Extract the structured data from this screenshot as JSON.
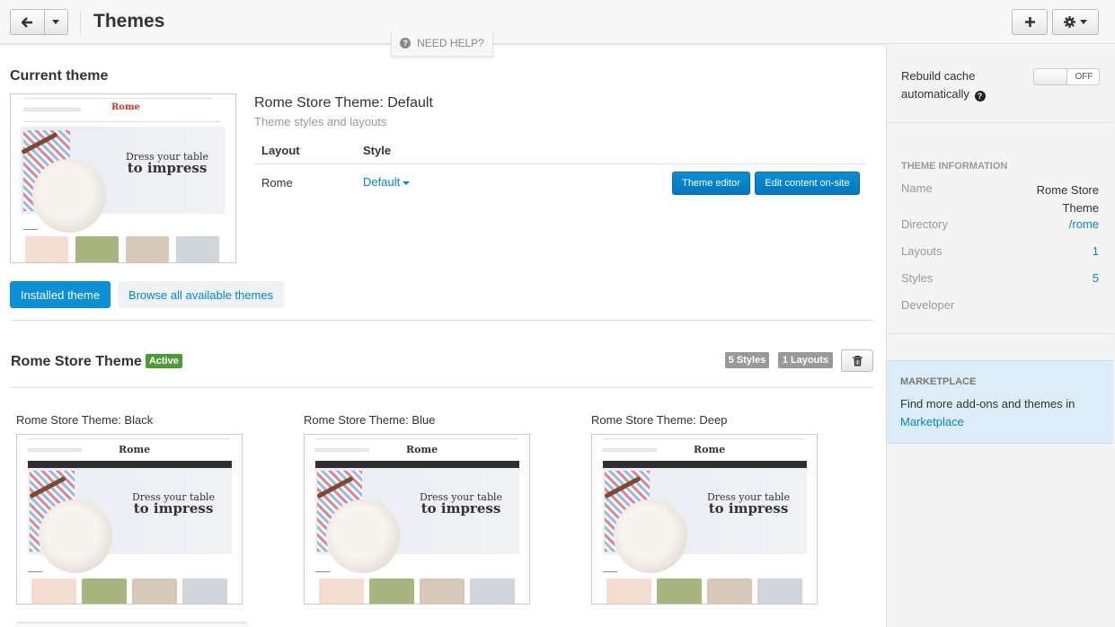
{
  "header": {
    "title": "Themes",
    "help_label": "NEED HELP?"
  },
  "current_theme": {
    "section_title": "Current theme",
    "heading": "Rome Store Theme: Default",
    "subheading": "Theme styles and layouts",
    "table": {
      "col_layout": "Layout",
      "col_style": "Style",
      "row_layout": "Rome",
      "row_style": "Default"
    },
    "theme_editor_label": "Theme editor",
    "edit_onsite_label": "Edit content on-site"
  },
  "tabs": {
    "installed": "Installed theme",
    "browse": "Browse all available themes"
  },
  "installed_theme": {
    "name": "Rome Store Theme",
    "status": "Active",
    "styles_count": "5 Styles",
    "layouts_count": "1 Layouts",
    "styles": [
      {
        "label": "Rome Store Theme: Black",
        "accent": "#2e2e2e"
      },
      {
        "label": "Rome Store Theme: Blue",
        "accent": "#2e2e2e"
      },
      {
        "label": "Rome Store Theme: Deep",
        "accent": "#2e2e2e"
      }
    ]
  },
  "preview": {
    "logo": "Rome",
    "headline_1": "Dress your table",
    "headline_2": "to impress"
  },
  "sidebar": {
    "rebuild_cache_label": "Rebuild cache automatically",
    "toggle_state": "OFF",
    "theme_info_caption": "THEME INFORMATION",
    "info": [
      {
        "label": "Name",
        "value": "Rome Store Theme"
      },
      {
        "label": "Directory",
        "value": "/rome"
      },
      {
        "label": "Layouts",
        "value": "1"
      },
      {
        "label": "Styles",
        "value": "5"
      },
      {
        "label": "Developer",
        "value": ""
      }
    ],
    "marketplace_caption": "MARKETPLACE",
    "marketplace_text": "Find more add-ons and themes in",
    "marketplace_link": "Marketplace"
  },
  "colors": {
    "primary": "#0a8fd8",
    "link": "#0388cc",
    "active_badge": "#4f9a35",
    "sidebar_bg": "#f4f4f4",
    "marketplace_bg": "#dcedf7"
  }
}
